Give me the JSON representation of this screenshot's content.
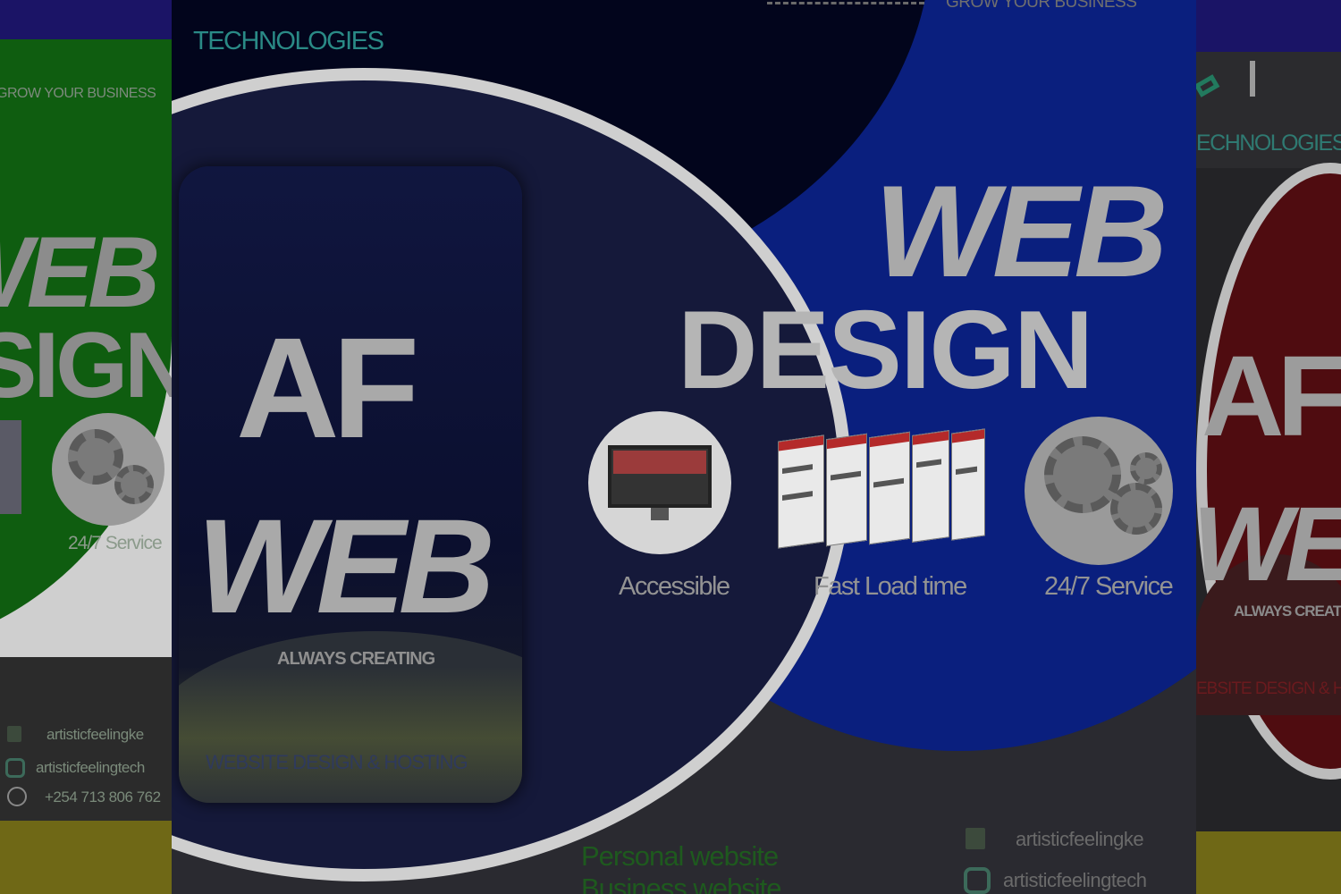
{
  "left_flyer": {
    "tagline": "GROW YOUR BUSINESS",
    "title_line1": "WEB",
    "title_line2": "SIGN",
    "service_label": "24/7 Service",
    "contacts": [
      {
        "icon": "facebook-icon",
        "text": "artisticfeelingke"
      },
      {
        "icon": "instagram-icon",
        "text": "artisticfeelingtech"
      },
      {
        "icon": "phone-icon",
        "text": "+254 713 806 762"
      }
    ],
    "colors": {
      "accent": "#0f5d10"
    }
  },
  "center_flyer": {
    "brand": "TECHNOLOGIES",
    "tagline": "GROW YOUR BUSINESS",
    "headline_line1": "WEB",
    "headline_line2": "DESIGN",
    "phone": {
      "logo_mark": "AF",
      "logo_word": "WEB",
      "slogan": "ALWAYS CREATING",
      "caption": "WEBSITE DESIGN & HOSTING"
    },
    "features": [
      {
        "label": "Accessible",
        "icon": "monitor-icon"
      },
      {
        "label": "Fast Load  time",
        "icon": "webpages-icon"
      },
      {
        "label": "24/7 Service",
        "icon": "gears-icon"
      }
    ],
    "services": [
      "Personal website",
      "Business website"
    ],
    "contacts": [
      {
        "icon": "facebook-icon",
        "text": "artisticfeelingke"
      },
      {
        "icon": "instagram-icon",
        "text": "artisticfeelingtech"
      }
    ],
    "colors": {
      "accent": "#0a1f7e",
      "green_text": "#1e5a1e"
    }
  },
  "right_flyer": {
    "brand": "ECHNOLOGIES",
    "logo_mark": "AF",
    "logo_word": "WE",
    "slogan": "ALWAYS CREATIN",
    "caption": "EBSITE DESIGN & HOS",
    "colors": {
      "accent": "#5c0d12"
    }
  }
}
